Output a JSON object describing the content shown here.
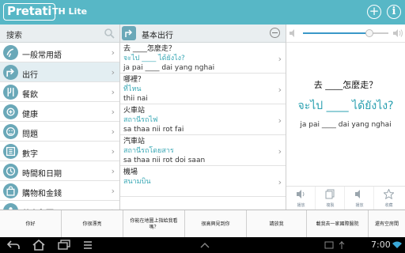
{
  "app": {
    "logo": "Pretati",
    "title": "TH Lite"
  },
  "titlebar": {
    "add_icon": "plus-circle-icon",
    "info_icon": "info-circle-icon"
  },
  "sidebar": {
    "search_label": "搜索",
    "items": [
      {
        "label": "一般常用語",
        "icon": "general-icon"
      },
      {
        "label": "出行",
        "icon": "travel-icon"
      },
      {
        "label": "餐飲",
        "icon": "dining-icon"
      },
      {
        "label": "健康",
        "icon": "health-icon"
      },
      {
        "label": "問題",
        "icon": "question-icon"
      },
      {
        "label": "數字",
        "icon": "numbers-icon"
      },
      {
        "label": "時間和日期",
        "icon": "clock-icon"
      },
      {
        "label": "購物和金錢",
        "icon": "shopping-icon"
      },
      {
        "label": "數人兒面",
        "icon": "people-icon"
      }
    ],
    "active_index": 1
  },
  "middle": {
    "header": "基本出行",
    "phrases": [
      {
        "zh": "去 ____怎麼走？",
        "th": "จะไป ____ ได้ยังไง?",
        "rom": "ja pai ____ dai yang nghai"
      },
      {
        "zh": "哪裡？",
        "th": "ที่ไหน",
        "rom": "thii nai"
      },
      {
        "zh": "火車站",
        "th": "สถานีรถไฟ",
        "rom": "sa thaa nii rot fai"
      },
      {
        "zh": "汽車站",
        "th": "สถานีรถโดยสาร",
        "rom": "sa thaa nii rot doi saan"
      },
      {
        "zh": "機場",
        "th": "สนามบิน",
        "rom": ""
      }
    ],
    "active_index": 0
  },
  "detail": {
    "volume": 0.78,
    "zh": "去 ____怎麼走？",
    "th": "จะไป ____ ได้ยังไง?",
    "rom": "ja pai ____ dai yang nghai",
    "actions": [
      {
        "label": "播放",
        "icon": "speaker-icon"
      },
      {
        "label": "複製",
        "icon": "copy-icon"
      },
      {
        "label": "播放",
        "icon": "speaker-slow-icon"
      },
      {
        "label": "收藏",
        "icon": "star-icon"
      }
    ]
  },
  "quickbar": {
    "items": [
      "你好",
      "你很漂亮",
      "你能在地圖上指給我看嗎？",
      "很高興見到你",
      "請放我",
      "載我去一家國際醫院",
      "還有空房間"
    ]
  },
  "system": {
    "time": "7:00"
  },
  "colors": {
    "accent": "#57b7c6",
    "thai_text": "#2aa0b0",
    "icon_bg": "#6aa8b8"
  }
}
